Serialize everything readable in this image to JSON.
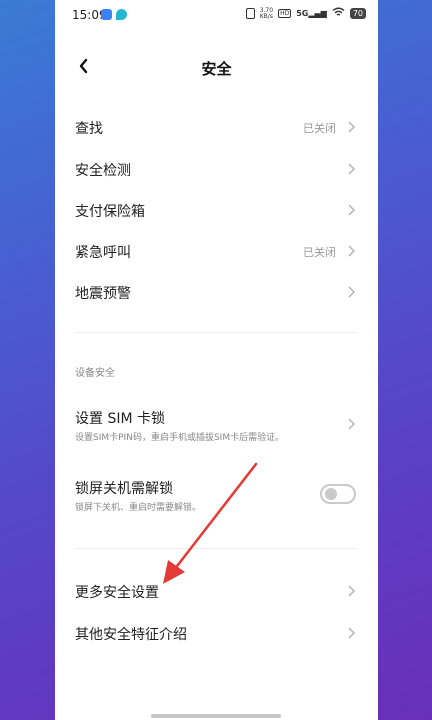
{
  "status": {
    "time": "15:09",
    "speed": "3.70\nKB/s",
    "network": "5G",
    "hd": "HD",
    "battery": "70",
    "icons": [
      "message-icon",
      "notification-drop-icon",
      "vibrate-icon",
      "hd-icon",
      "signal-icon",
      "wifi-icon",
      "battery-icon"
    ]
  },
  "nav": {
    "title": "安全",
    "back_icon": "chevron-left-icon"
  },
  "menu": [
    {
      "label": "查找",
      "value": "已关闭"
    },
    {
      "label": "安全检测",
      "value": ""
    },
    {
      "label": "支付保险箱",
      "value": ""
    },
    {
      "label": "紧急呼叫",
      "value": "已关闭"
    },
    {
      "label": "地震预警",
      "value": ""
    }
  ],
  "device_security": {
    "header": "设备安全",
    "sim_lock": {
      "label": "设置 SIM 卡锁",
      "desc": "设置SIM卡PIN码，重启手机或插拔SIM卡后需验证。"
    },
    "unlock_shutdown": {
      "label": "锁屏关机需解锁",
      "desc": "锁屏下关机、重启时需要解锁。",
      "enabled": false
    }
  },
  "more": [
    {
      "label": "更多安全设置"
    },
    {
      "label": "其他安全特征介绍"
    }
  ],
  "colors": {
    "annotation_arrow": "#e53935",
    "accent_bg": "#4a5bd0"
  }
}
